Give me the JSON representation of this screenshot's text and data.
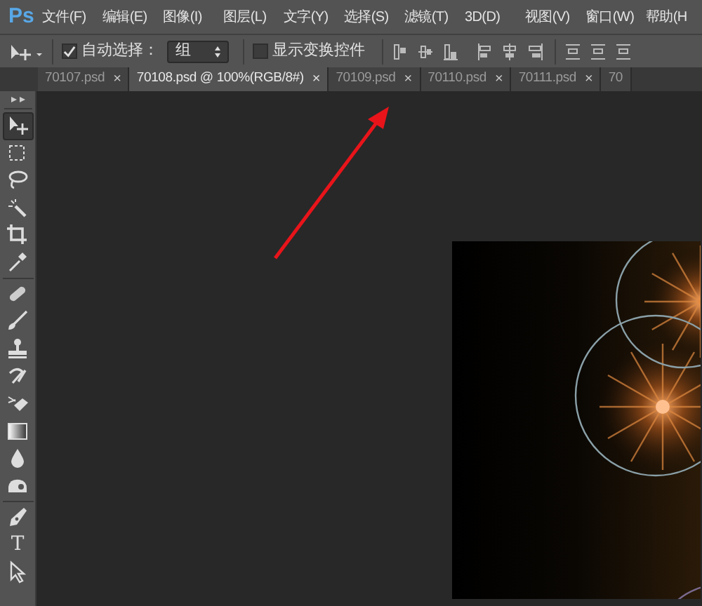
{
  "app": {
    "logo": "Ps"
  },
  "menu": [
    "文件(F)",
    "编辑(E)",
    "图像(I)",
    "图层(L)",
    "文字(Y)",
    "选择(S)",
    "滤镜(T)",
    "3D(D)",
    "视图(V)",
    "窗口(W)",
    "帮助(H"
  ],
  "options_bar": {
    "auto_select": {
      "label": "自动选择：",
      "checked": true
    },
    "target": {
      "value": "组"
    },
    "show_transform": {
      "label": "显示变换控件",
      "checked": false
    }
  },
  "tabs": [
    {
      "label": "70107.psd",
      "close": "×",
      "selected": false
    },
    {
      "label": "70108.psd @ 100%(RGB/8#)",
      "close": "×",
      "selected": true
    },
    {
      "label": "70109.psd",
      "close": "×",
      "selected": false
    },
    {
      "label": "70110.psd",
      "close": "×",
      "selected": false
    },
    {
      "label": "70111.psd",
      "close": "×",
      "selected": false
    },
    {
      "label": "70",
      "selected": false
    }
  ],
  "tools": [
    {
      "kind": "move",
      "selected": true
    },
    {
      "kind": "marquee",
      "selected": false
    },
    {
      "kind": "lasso",
      "selected": false
    },
    {
      "kind": "wand",
      "selected": false
    },
    {
      "kind": "crop",
      "selected": false
    },
    {
      "kind": "eyedropper",
      "selected": false
    },
    {
      "kind": "heal",
      "selected": false
    },
    {
      "kind": "brush",
      "selected": false
    },
    {
      "kind": "stamp",
      "selected": false
    },
    {
      "kind": "history",
      "selected": false
    },
    {
      "kind": "eraser",
      "selected": false
    },
    {
      "kind": "gradient",
      "selected": false
    },
    {
      "kind": "blur",
      "selected": false
    },
    {
      "kind": "dodge",
      "selected": false
    },
    {
      "kind": "pen",
      "selected": false
    },
    {
      "kind": "type",
      "label": "T",
      "selected": false
    },
    {
      "kind": "select",
      "selected": false
    }
  ]
}
